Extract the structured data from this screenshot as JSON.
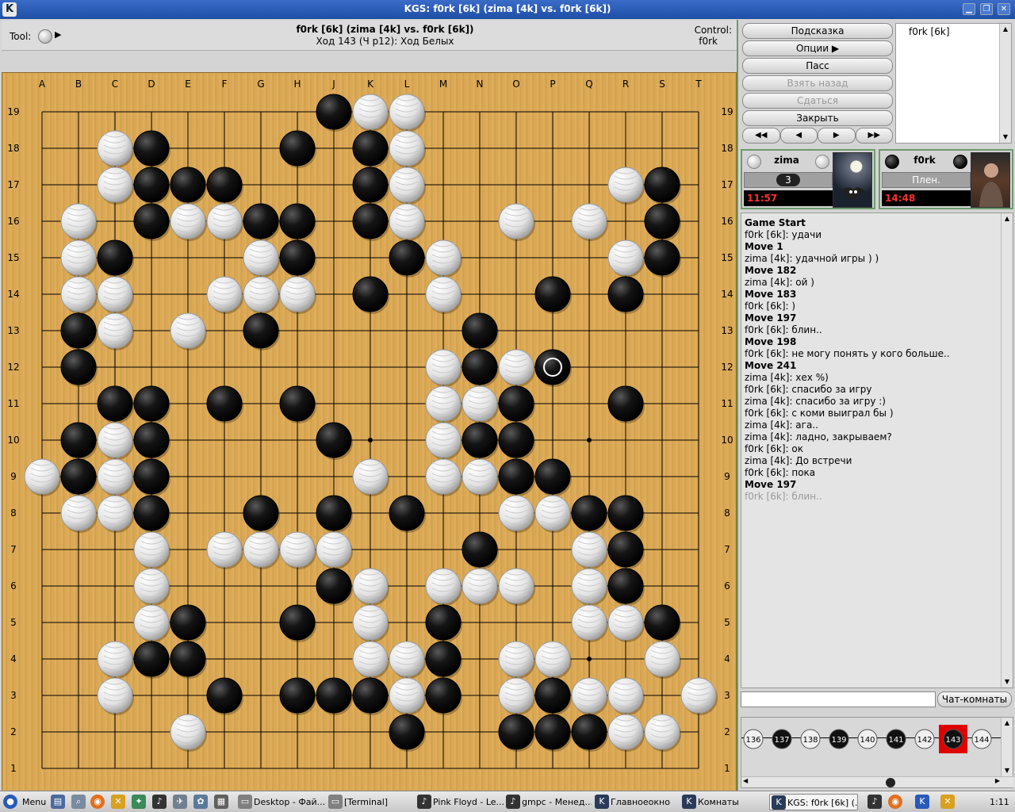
{
  "window": {
    "title": "KGS: f0rk [6k] (zima [4k] vs. f0rk [6k])",
    "app_icon": "K"
  },
  "infobar": {
    "tool_label": "Tool:",
    "game_title": "f0rk [6k] (zima [4k] vs. f0rk [6k])",
    "move_info": "Ход 143 (Ч p12): Ход Белых",
    "control_label": "Control:",
    "control_value": "f0rk"
  },
  "board": {
    "columns": [
      "A",
      "B",
      "C",
      "D",
      "E",
      "F",
      "G",
      "H",
      "J",
      "K",
      "L",
      "M",
      "N",
      "O",
      "P",
      "Q",
      "R",
      "S",
      "T"
    ],
    "rows": [
      "19",
      "18",
      "17",
      "16",
      "15",
      "14",
      "13",
      "12",
      "11",
      "10",
      "9",
      "8",
      "7",
      "6",
      "5",
      "4",
      "3",
      "2",
      "1"
    ],
    "last_move": "P12",
    "black_stones": [
      "J19",
      "D18",
      "H18",
      "K18",
      "D17",
      "E17",
      "F17",
      "K17",
      "S17",
      "D16",
      "G16",
      "H16",
      "K16",
      "S16",
      "C15",
      "H15",
      "L15",
      "S15",
      "K14",
      "P14",
      "R14",
      "B13",
      "G13",
      "N13",
      "B12",
      "N12",
      "P12",
      "C11",
      "D11",
      "F11",
      "H11",
      "O11",
      "R11",
      "B10",
      "D10",
      "J10",
      "N10",
      "O10",
      "B9",
      "D9",
      "O9",
      "P9",
      "D8",
      "G8",
      "J8",
      "L8",
      "Q8",
      "R8",
      "N7",
      "R7",
      "J6",
      "R6",
      "E5",
      "H5",
      "M5",
      "S5",
      "D4",
      "E4",
      "M4",
      "F3",
      "H3",
      "J3",
      "K3",
      "M3",
      "P3",
      "L2",
      "O2",
      "P2",
      "Q2"
    ],
    "white_stones": [
      "K19",
      "L19",
      "C18",
      "L18",
      "C17",
      "L17",
      "R17",
      "B16",
      "E16",
      "F16",
      "L16",
      "O16",
      "Q16",
      "B15",
      "G15",
      "M15",
      "R15",
      "B14",
      "C14",
      "F14",
      "G14",
      "H14",
      "M14",
      "C13",
      "E13",
      "M12",
      "O12",
      "M11",
      "N11",
      "C10",
      "M10",
      "A9",
      "C9",
      "K9",
      "M9",
      "N9",
      "B8",
      "C8",
      "O8",
      "P8",
      "D7",
      "F7",
      "G7",
      "H7",
      "J7",
      "Q7",
      "D6",
      "K6",
      "M6",
      "N6",
      "O6",
      "Q6",
      "D5",
      "K5",
      "Q5",
      "R5",
      "C4",
      "K4",
      "L4",
      "O4",
      "P4",
      "S4",
      "C3",
      "L3",
      "O3",
      "Q3",
      "R3",
      "T3",
      "E2",
      "R2",
      "S2"
    ]
  },
  "buttons": {
    "hint": "Подсказка",
    "options": "Опции",
    "pass": "Пасс",
    "undo": "Взять назад",
    "resign": "Сдаться",
    "close": "Закрыть"
  },
  "userlist": [
    "f0rk [6k]"
  ],
  "players": {
    "white": {
      "name": "zima",
      "captures": "3",
      "time": "11:57"
    },
    "black": {
      "name": "f0rk",
      "status": "Плен.",
      "time": "14:48"
    }
  },
  "chat": {
    "lines": [
      {
        "text": "Game Start",
        "style": "b"
      },
      {
        "text": "f0rk [6k]: удачи",
        "style": ""
      },
      {
        "text": "Move 1",
        "style": "b"
      },
      {
        "text": "zima [4k]: удачной игры ) )",
        "style": ""
      },
      {
        "text": "Move 182",
        "style": "b"
      },
      {
        "text": "zima [4k]: ой )",
        "style": ""
      },
      {
        "text": "Move 183",
        "style": "b"
      },
      {
        "text": "f0rk [6k]: )",
        "style": ""
      },
      {
        "text": "Move 197",
        "style": "b"
      },
      {
        "text": "f0rk [6k]: блин..",
        "style": ""
      },
      {
        "text": "Move 198",
        "style": "b"
      },
      {
        "text": "f0rk [6k]: не могу понять  у кого больше..",
        "style": ""
      },
      {
        "text": "Move 241",
        "style": "b"
      },
      {
        "text": "zima [4k]: хех %)",
        "style": ""
      },
      {
        "text": "f0rk [6k]: спасибо за игру",
        "style": ""
      },
      {
        "text": "zima [4k]: спасибо за игру :)",
        "style": ""
      },
      {
        "text": "f0rk [6k]: с коми выиграл бы )",
        "style": ""
      },
      {
        "text": "zima [4k]: ага..",
        "style": ""
      },
      {
        "text": "zima [4k]: ладно, закрываем?",
        "style": ""
      },
      {
        "text": "f0rk [6k]: ок",
        "style": ""
      },
      {
        "text": "zima [4k]: До встречи",
        "style": ""
      },
      {
        "text": "f0rk [6k]: пока",
        "style": ""
      },
      {
        "text": "Move 197",
        "style": "b"
      },
      {
        "text": "f0rk [6k]: блин..",
        "style": "g"
      }
    ],
    "rooms_button": "Чат-комнаты"
  },
  "move_tree": [
    {
      "n": "136",
      "color": "white"
    },
    {
      "n": "137",
      "color": "black"
    },
    {
      "n": "138",
      "color": "white"
    },
    {
      "n": "139",
      "color": "black"
    },
    {
      "n": "140",
      "color": "white"
    },
    {
      "n": "141",
      "color": "black"
    },
    {
      "n": "142",
      "color": "white"
    },
    {
      "n": "143",
      "color": "black",
      "current": true
    },
    {
      "n": "144",
      "color": "white"
    }
  ],
  "taskbar": {
    "menu": "Menu",
    "items": [
      "Desktop - Фай...",
      "[Terminal]",
      "Pink Floyd - Le...",
      "gmpc - Менед...",
      "Главноеокно",
      "Комнаты",
      "KGS: f0rk [6k] (..."
    ],
    "clock": "1:11"
  },
  "colors": {
    "board": "#dcaa57",
    "accent": "#1e4ea6",
    "clock_text": "#ff3030",
    "current_move": "#e00000"
  }
}
